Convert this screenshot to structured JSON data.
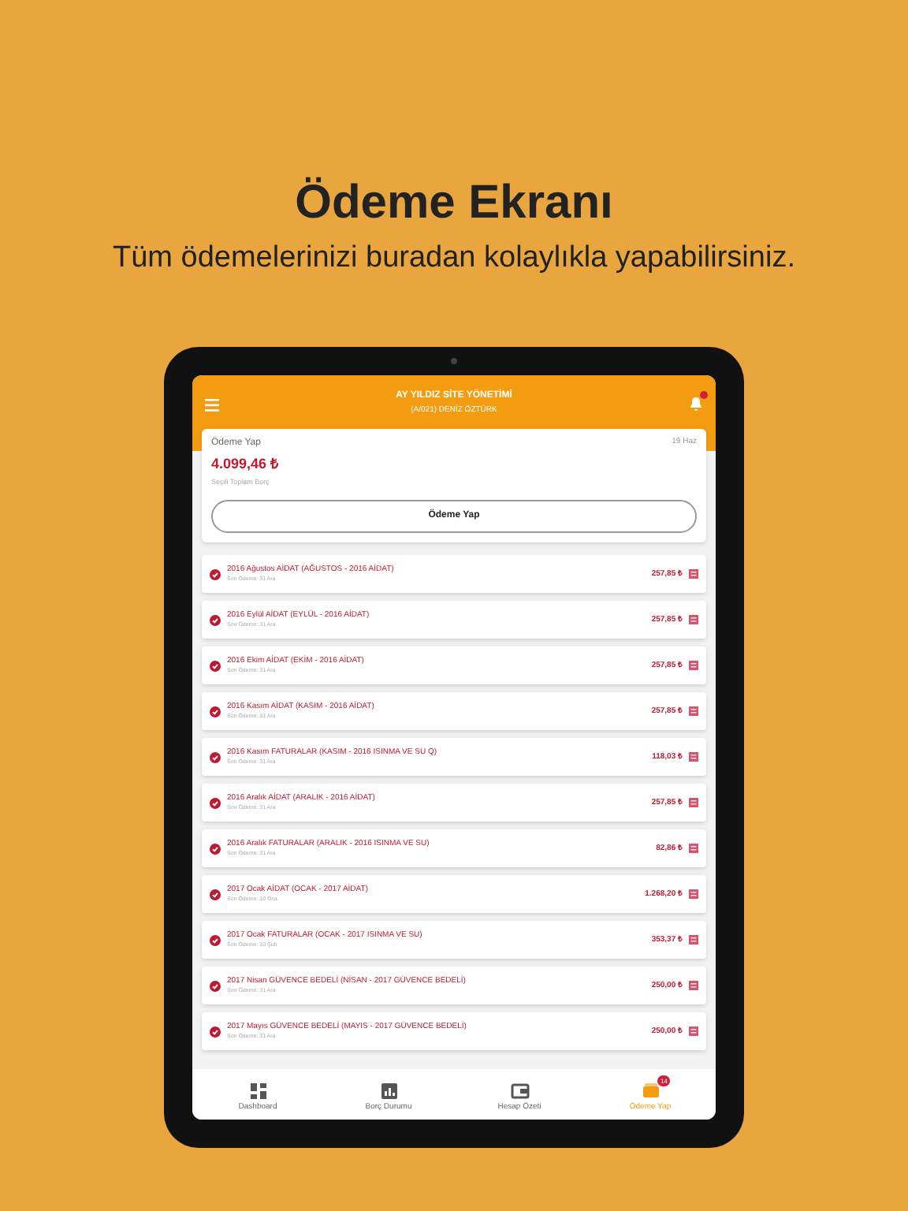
{
  "promo": {
    "title": "Ödeme Ekranı",
    "subtitle": "Tüm ödemelerinizi buradan kolaylıkla yapabilirsiniz."
  },
  "header": {
    "title": "AY YILDIZ SİTE YÖNETİMİ",
    "subtitle": "(A/021) DENİZ ÖZTÜRK",
    "has_notification": true
  },
  "summary": {
    "label": "Ödeme Yap",
    "date": "19 Haz",
    "amount": "4.099,46 ₺",
    "caption": "Seçili Toplam Borç",
    "button": "Ödeme Yap"
  },
  "items": [
    {
      "title": "2016 Ağustos AİDAT (AĞUSTOS - 2016 AİDAT)",
      "due": "Son Ödeme: 31 Ara",
      "amount": "257,85 ₺",
      "checked": true
    },
    {
      "title": "2016 Eylül AİDAT (EYLÜL - 2016 AİDAT)",
      "due": "Son Ödeme: 31 Ara",
      "amount": "257,85 ₺",
      "checked": true
    },
    {
      "title": "2016 Ekim AİDAT (EKİM - 2016 AİDAT)",
      "due": "Son Ödeme: 31 Ara",
      "amount": "257,85 ₺",
      "checked": true
    },
    {
      "title": "2016 Kasım AİDAT (KASIM - 2016 AİDAT)",
      "due": "Son Ödeme: 31 Ara",
      "amount": "257,85 ₺",
      "checked": true
    },
    {
      "title": "2016 Kasım FATURALAR (KASIM - 2016 ISINMA VE SU Q)",
      "due": "Son Ödeme: 31 Ara",
      "amount": "118,03 ₺",
      "checked": true
    },
    {
      "title": "2016 Aralık AİDAT (ARALIK - 2016 AİDAT)",
      "due": "Son Ödeme: 31 Ara",
      "amount": "257,85 ₺",
      "checked": true
    },
    {
      "title": "2016 Aralık FATURALAR (ARALIK - 2016 ISINMA VE SU)",
      "due": "Son Ödeme: 31 Ara",
      "amount": "82,86 ₺",
      "checked": true
    },
    {
      "title": "2017 Ocak AİDAT (OCAK - 2017 AİDAT)",
      "due": "Son Ödeme: 10 Oca",
      "amount": "1.268,20 ₺",
      "checked": true
    },
    {
      "title": "2017 Ocak FATURALAR (OCAK - 2017 ISINMA VE SU)",
      "due": "Son Ödeme: 10 Şub",
      "amount": "353,37 ₺",
      "checked": true
    },
    {
      "title": "2017 Nisan GÜVENCE BEDELİ (NİSAN - 2017 GÜVENCE BEDELİ)",
      "due": "Son Ödeme: 31 Ara",
      "amount": "250,00 ₺",
      "checked": true
    },
    {
      "title": "2017 Mayıs GÜVENCE BEDELİ (MAYIS - 2017 GÜVENCE BEDELİ)",
      "due": "Son Ödeme: 31 Ara",
      "amount": "250,00 ₺",
      "checked": true
    }
  ],
  "tabs": [
    {
      "label": "Dashboard",
      "kind": "grid",
      "selected": false
    },
    {
      "label": "Borç Durumu",
      "kind": "chart",
      "selected": false
    },
    {
      "label": "Hesap Özeti",
      "kind": "wallet",
      "selected": false
    },
    {
      "label": "Ödeme Yap",
      "kind": "cash",
      "selected": true,
      "badge": "14"
    }
  ]
}
